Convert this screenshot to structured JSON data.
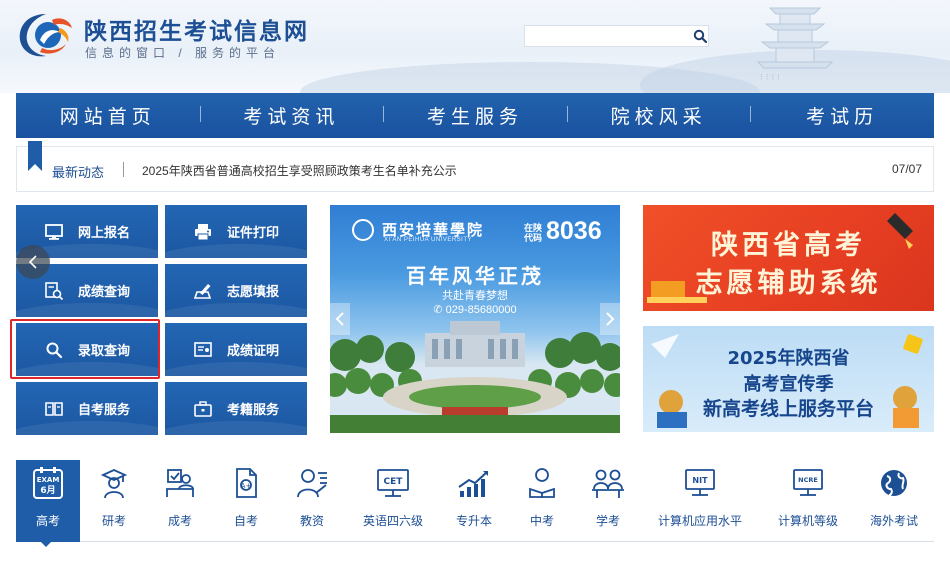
{
  "header": {
    "title": "陕西招生考试信息网",
    "slogan": "信息的窗口 / 服务的平台",
    "search_placeholder": ""
  },
  "nav": {
    "items": [
      "网站首页",
      "考试资讯",
      "考生服务",
      "院校风采",
      "考试历"
    ]
  },
  "news": {
    "label": "最新动态",
    "headline": "2025年陕西省普通高校招生享受照顾政策考生名单补充公示",
    "date": "07/07"
  },
  "services": [
    {
      "label": "网上报名",
      "icon": "monitor-icon"
    },
    {
      "label": "证件打印",
      "icon": "printer-icon"
    },
    {
      "label": "成绩查询",
      "icon": "score-search-icon"
    },
    {
      "label": "志愿填报",
      "icon": "form-pen-icon"
    },
    {
      "label": "录取查询",
      "icon": "search-icon"
    },
    {
      "label": "成绩证明",
      "icon": "certificate-icon"
    },
    {
      "label": "自考服务",
      "icon": "book-icon"
    },
    {
      "label": "考籍服务",
      "icon": "briefcase-icon"
    }
  ],
  "banner": {
    "school_cn": "西安培華學院",
    "school_en": "XI'AN PEIHUA UNIVERSITY",
    "code_label": "在陕代码",
    "code": "8036",
    "slogan": "百年风华正茂",
    "sub": "共赴青春梦想",
    "phone": "029-85680000"
  },
  "ads": {
    "ad1_line1": "陕西省高考",
    "ad1_line2": "志愿辅助系统",
    "ad2_line1": "2025年陕西省",
    "ad2_line2": "高考宣传季",
    "ad2_line3": "新高考线上服务平台"
  },
  "categories": [
    {
      "label": "高考",
      "icon": "exam-calendar-icon",
      "badge_top": "EXAM",
      "badge_bottom": "6月"
    },
    {
      "label": "研考",
      "icon": "graduate-icon"
    },
    {
      "label": "成考",
      "icon": "checklist-person-icon"
    },
    {
      "label": "自考",
      "icon": "self-study-doc-icon"
    },
    {
      "label": "教资",
      "icon": "teacher-icon"
    },
    {
      "label": "英语四六级",
      "icon": "cet-icon",
      "badge": "CET"
    },
    {
      "label": "专升本",
      "icon": "growth-chart-icon"
    },
    {
      "label": "中考",
      "icon": "student-reading-icon"
    },
    {
      "label": "学考",
      "icon": "students-desk-icon"
    },
    {
      "label": "计算机应用水平",
      "icon": "nit-monitor-icon",
      "badge": "NIT"
    },
    {
      "label": "计算机等级",
      "icon": "ncre-monitor-icon",
      "badge": "NCRE"
    },
    {
      "label": "海外考试",
      "icon": "globe-icon"
    }
  ],
  "colors": {
    "brand_blue": "#1f5da8",
    "highlight_red": "#e0262d",
    "ad_orange": "#e63e22"
  }
}
